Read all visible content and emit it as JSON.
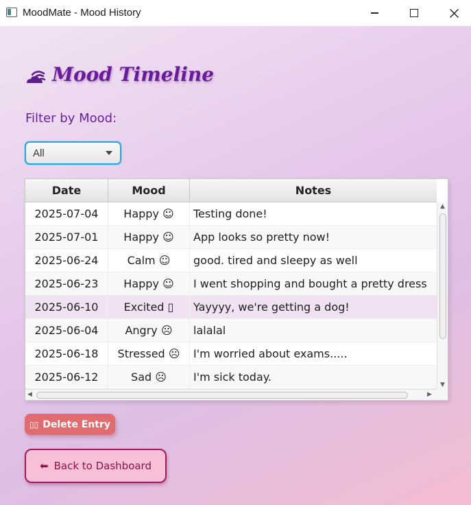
{
  "window": {
    "title": "MoodMate - Mood History"
  },
  "heading": {
    "title": "Mood Timeline",
    "icon": "cloud-wave-icon"
  },
  "filter": {
    "label": "Filter by Mood:",
    "selected": "All"
  },
  "table": {
    "columns": [
      "Date",
      "Mood",
      "Notes"
    ],
    "rows": [
      {
        "date": "2025-07-04",
        "mood": "Happy ☺",
        "notes": "Testing done!"
      },
      {
        "date": "2025-07-01",
        "mood": "Happy ☺",
        "notes": "App looks so pretty now!"
      },
      {
        "date": "2025-06-24",
        "mood": "Calm ☺",
        "notes": "good. tired and sleepy as well"
      },
      {
        "date": "2025-06-23",
        "mood": "Happy ☺",
        "notes": "I went shopping and bought a pretty dress"
      },
      {
        "date": "2025-06-10",
        "mood": "Excited ▯",
        "notes": "Yayyyy, we're getting a dog!"
      },
      {
        "date": "2025-06-04",
        "mood": "Angry ☹",
        "notes": "lalalal"
      },
      {
        "date": "2025-06-18",
        "mood": "Stressed ☹",
        "notes": "I'm worried about exams....."
      },
      {
        "date": "2025-06-12",
        "mood": "Sad ☹",
        "notes": "I'm sick today."
      }
    ],
    "selected_row": 4
  },
  "buttons": {
    "delete_icon": "▯▯",
    "delete_label": "Delete Entry",
    "back_arrow": "⬅",
    "back_label": "Back to Dashboard"
  },
  "colors": {
    "heading": "#6a1b9a",
    "delete_button": "#e06c6f",
    "back_button_border": "#a2175a",
    "selected_row": "#f1e1f3"
  }
}
